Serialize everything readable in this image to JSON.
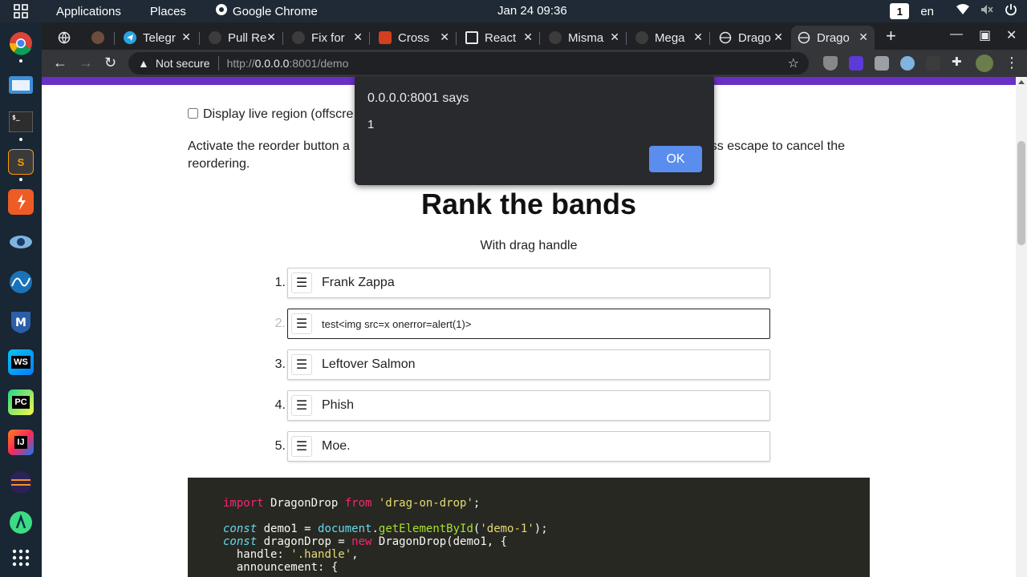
{
  "topbar": {
    "applications": "Applications",
    "places": "Places",
    "chrome": "Google Chrome",
    "clock": "Jan 24  09:36",
    "workspace": "1",
    "lang": "en"
  },
  "tabs": [
    {
      "label": "",
      "fav_color": "#5f6368"
    },
    {
      "label": "",
      "fav_color": "#8a6d5b"
    },
    {
      "label": "Telegr",
      "fav_color": "#2aa3e0"
    },
    {
      "label": "Pull Re",
      "fav_color": "#3c3c3c"
    },
    {
      "label": "Fix for",
      "fav_color": "#3c3c3c"
    },
    {
      "label": "Cross",
      "fav_color": "#d33f1f"
    },
    {
      "label": "React",
      "fav_color": "#ffffff"
    },
    {
      "label": "Misma",
      "fav_color": "#3c3c3c"
    },
    {
      "label": "Mega",
      "fav_color": "#3c3c3c"
    },
    {
      "label": "Drago",
      "fav_color": "#5f6368"
    },
    {
      "label": "Drago",
      "fav_color": "#5f6368"
    }
  ],
  "toolbar": {
    "not_secure": "Not secure",
    "url_scheme": "http://",
    "url_host": "0.0.0.0",
    "url_rest": ":8001/demo"
  },
  "page": {
    "live_region_label": "Display live region (offscre",
    "instructions": "Activate the reorder button a                                                                            rag/reorder. Press escape to cancel the reordering.",
    "heading": "Rank the bands",
    "subheading": "With drag handle",
    "items": [
      {
        "num": "1.",
        "label": "Frank Zappa"
      },
      {
        "num": "2.",
        "label": "test<img src=x onerror=alert(1)>"
      },
      {
        "num": "3.",
        "label": "Leftover Salmon"
      },
      {
        "num": "4.",
        "label": "Phish"
      },
      {
        "num": "5.",
        "label": "Moe."
      }
    ],
    "code": {
      "l1_kw": "import",
      "l1_id": " DragonDrop ",
      "l1_from": "from",
      "l1_str": " 'drag-on-drop'",
      "l1_end": ";",
      "l2_kw": "const",
      "l2_id": " demo1 = ",
      "l2_obj": "document",
      "l2_dot": ".",
      "l2_fn": "getElementById",
      "l2_open": "(",
      "l2_str": "'demo-1'",
      "l2_end": ");",
      "l3_kw": "const",
      "l3_id": " dragonDrop = ",
      "l3_new": "new",
      "l3_rest": " DragonDrop(demo1, {",
      "l4_key": "  handle: ",
      "l4_str": "'.handle'",
      "l4_end": ",",
      "l5": "  announcement: {"
    }
  },
  "alert": {
    "title": "0.0.0.0:8001 says",
    "message": "1",
    "ok": "OK"
  },
  "colors": {
    "accent_purple": "#6a2fc4",
    "ok_button": "#5b8def"
  }
}
